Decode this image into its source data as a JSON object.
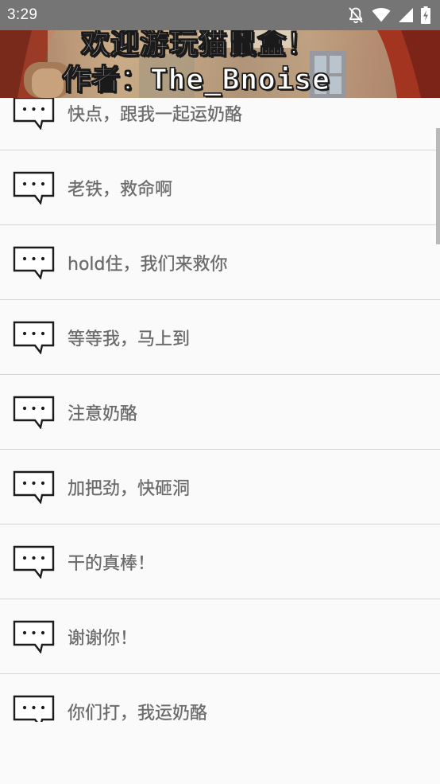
{
  "status_bar": {
    "time": "3:29",
    "icons": [
      "notifications-off-icon",
      "wifi-icon",
      "signal-icon",
      "battery-charging-icon"
    ]
  },
  "banner": {
    "title": "欢迎游玩猫鼠盒！",
    "author": "作者：The_Bnoise"
  },
  "messages": [
    {
      "label": "快点，跟我一起运奶酪",
      "icon": "speech-bubble-icon"
    },
    {
      "label": "老铁，救命啊",
      "icon": "speech-bubble-icon"
    },
    {
      "label": "hold住，我们来救你",
      "icon": "speech-bubble-icon"
    },
    {
      "label": "等等我，马上到",
      "icon": "speech-bubble-icon"
    },
    {
      "label": "注意奶酪",
      "icon": "speech-bubble-icon"
    },
    {
      "label": "加把劲，快砸洞",
      "icon": "speech-bubble-icon"
    },
    {
      "label": "干的真棒！",
      "icon": "speech-bubble-icon"
    },
    {
      "label": "谢谢你！",
      "icon": "speech-bubble-icon"
    },
    {
      "label": "你们打，我运奶酪",
      "icon": "speech-bubble-icon"
    }
  ],
  "colors": {
    "status_bar": "#757575",
    "background": "#fafafa",
    "divider": "#d6d6d6",
    "item_text": "#6b6b6b",
    "scrollbar": "#b9b9b9"
  }
}
